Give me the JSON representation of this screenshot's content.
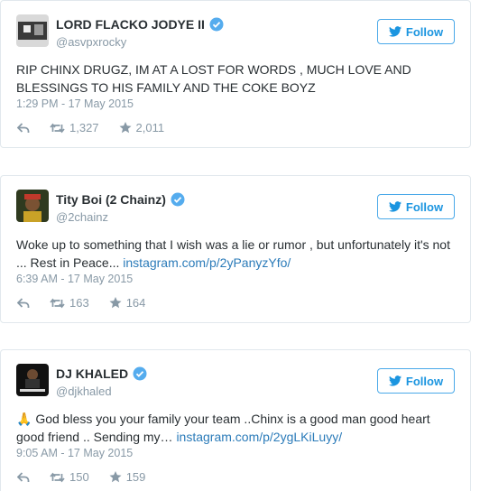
{
  "follow_label": "Follow",
  "colors": {
    "accent": "#1b95e0",
    "verified": "#55acee",
    "meta": "#8899a6"
  },
  "tweets": [
    {
      "name": "LORD FLACKO JODYE II",
      "handle": "@asvpxrocky",
      "text": "RIP CHINX DRUGZ, IM AT A LOST FOR WORDS , MUCH LOVE AND BLESSINGS TO HIS FAMILY AND THE COKE BOYZ",
      "link": "",
      "time": "1:29 PM - 17 May 2015",
      "retweets": "1,327",
      "likes": "2,011"
    },
    {
      "name": "Tity Boi (2 Chainz)",
      "handle": "@2chainz",
      "text": "Woke up to something that I wish was a lie or rumor , but unfortunately it's not ... Rest in Peace...",
      "link": "instagram.com/p/2yPanyzYfo/",
      "time": "6:39 AM - 17 May 2015",
      "retweets": "163",
      "likes": "164"
    },
    {
      "name": "DJ KHALED",
      "handle": "@djkhaled",
      "emoji": "🙏",
      "text": "God bless you your family your team ..Chinx is a good man good heart good friend .. Sending my…",
      "link": "instagram.com/p/2ygLKiLuyy/",
      "time": "9:05 AM - 17 May 2015",
      "retweets": "150",
      "likes": "159"
    }
  ]
}
